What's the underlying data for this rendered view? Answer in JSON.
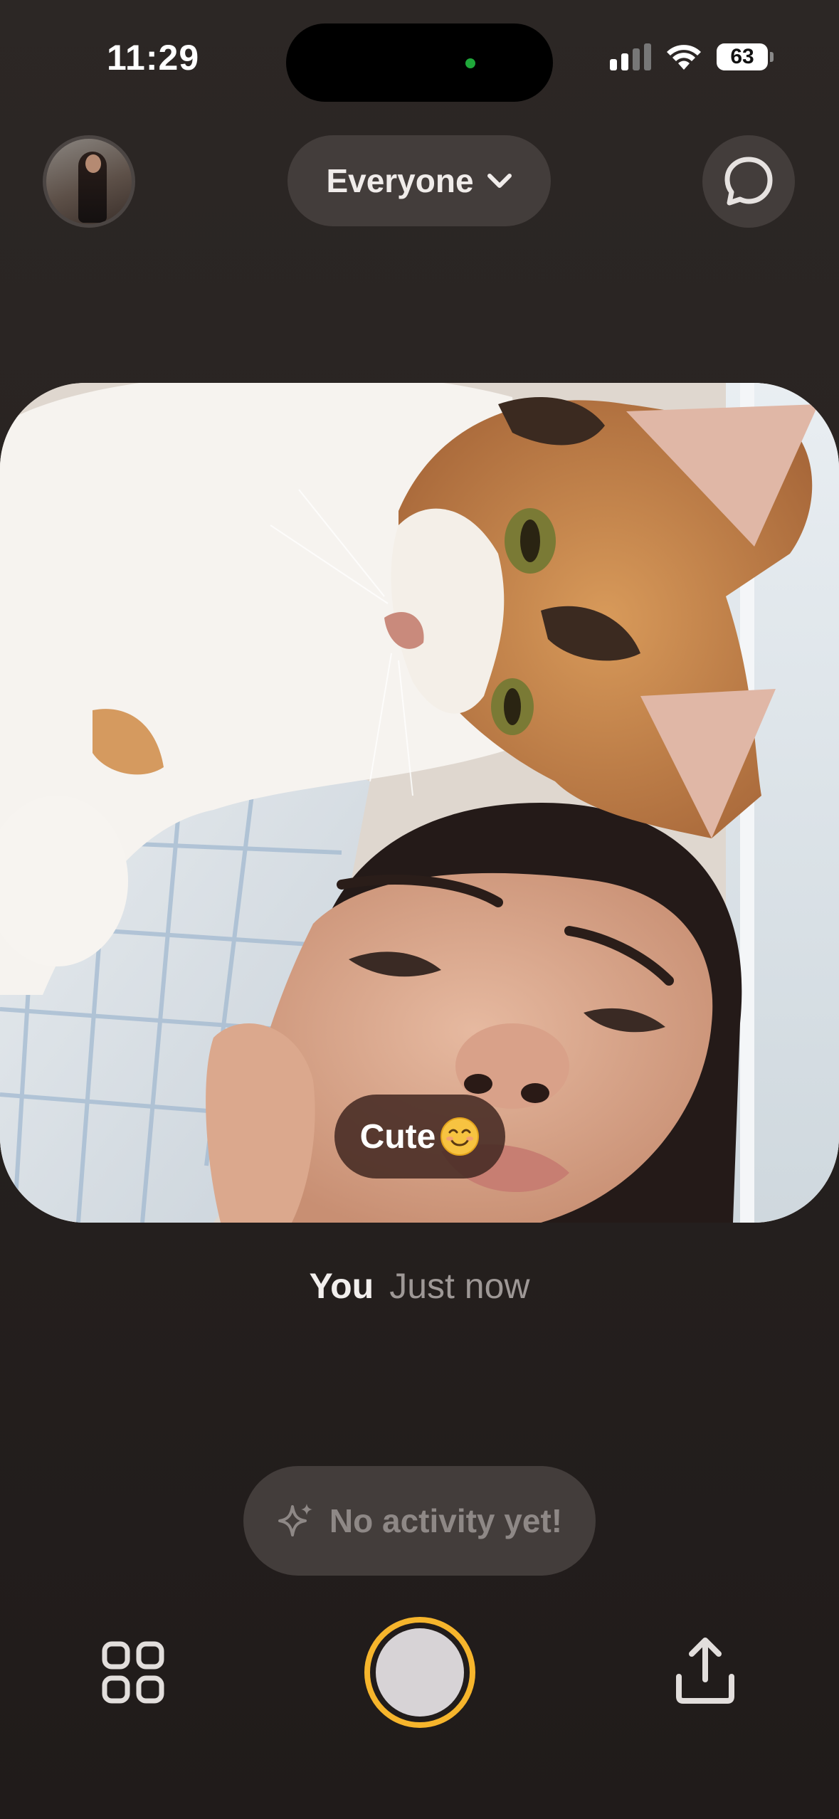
{
  "status_bar": {
    "time": "11:29",
    "battery": "63",
    "signal_bars_active": 2,
    "signal_bars_total": 4,
    "icons": [
      "cellular-signal-icon",
      "wifi-icon",
      "battery-icon"
    ]
  },
  "header": {
    "audience_label": "Everyone",
    "icons": [
      "profile-avatar",
      "chevron-down-icon",
      "chat-bubble-icon"
    ]
  },
  "post": {
    "caption": "Cute",
    "caption_emoji": "smiling-face-emoji",
    "author": "You",
    "timestamp": "Just now"
  },
  "activity": {
    "label": "No activity yet!",
    "icon": "sparkles-icon"
  },
  "bottom_bar": {
    "icons": [
      "grid-icon",
      "shutter-button",
      "share-icon"
    ]
  },
  "colors": {
    "background": "#272220",
    "pill": "#433d3b",
    "shutter_ring": "#f6b52c",
    "shutter_fill": "#d7d3d6",
    "caption_bg": "#462a23",
    "muted_text": "#8e8886"
  }
}
